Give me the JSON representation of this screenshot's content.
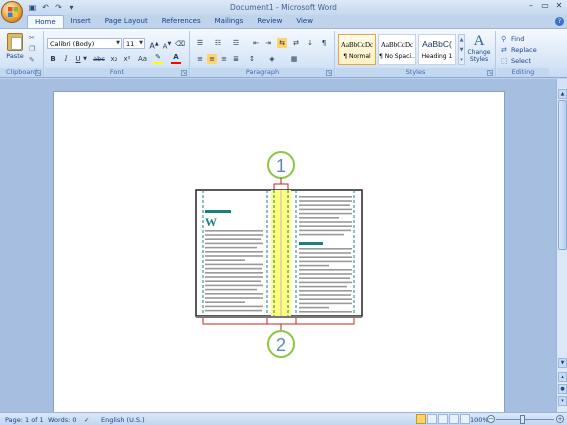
{
  "window": {
    "title": "Document1 - Microsoft Word"
  },
  "quick_access": {
    "save_icon": "save-icon",
    "undo_icon": "undo-icon",
    "redo_icon": "redo-icon",
    "customize_icon": "customize-icon"
  },
  "tabs": [
    {
      "label": "Home",
      "active": true
    },
    {
      "label": "Insert",
      "active": false
    },
    {
      "label": "Page Layout",
      "active": false
    },
    {
      "label": "References",
      "active": false
    },
    {
      "label": "Mailings",
      "active": false
    },
    {
      "label": "Review",
      "active": false
    },
    {
      "label": "View",
      "active": false
    }
  ],
  "ribbon": {
    "clipboard": {
      "label": "Clipboard",
      "paste_label": "Paste"
    },
    "font": {
      "label": "Font",
      "font_name": "Calibri (Body)",
      "font_size": "11",
      "bold": "B",
      "italic": "I",
      "underline": "U",
      "strikethrough": "abc",
      "subscript": "x₂",
      "superscript": "x²",
      "change_case": "Aa",
      "grow": "A",
      "shrink": "A",
      "highlight_color": "#ffff00",
      "font_color": "#ff0000"
    },
    "paragraph": {
      "label": "Paragraph",
      "sort": "↓",
      "show_marks": "¶"
    },
    "styles": {
      "label": "Styles",
      "items": [
        {
          "sample": "AaBbCcDc",
          "name": "¶ Normal",
          "selected": true
        },
        {
          "sample": "AaBbCcDc",
          "name": "¶ No Spaci...",
          "selected": false
        },
        {
          "sample": "AaBbC(",
          "name": "Heading 1",
          "selected": false
        }
      ],
      "change_styles_label_1": "Change",
      "change_styles_label_2": "Styles"
    },
    "editing": {
      "label": "Editing",
      "find": "Find",
      "replace": "Replace",
      "select": "Select"
    }
  },
  "figure": {
    "callout_1": "1",
    "callout_2": "2",
    "column_initial": "W",
    "accent_color": "#1a7f7f",
    "gutter_color": "#ffff7f",
    "callout_color": "#8dc63f",
    "bracket_color": "#cc2222"
  },
  "status": {
    "page": "Page: 1 of 1",
    "words": "Words: 0",
    "language": "English (U.S.)",
    "zoom": "100%"
  }
}
